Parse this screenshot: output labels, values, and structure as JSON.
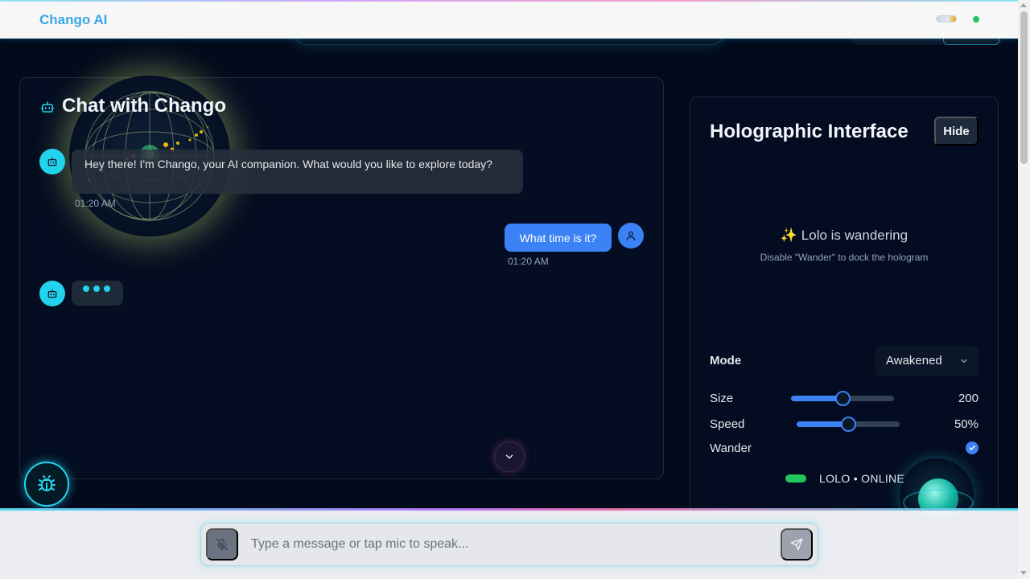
{
  "header": {
    "brand": "Chango AI",
    "theme_toggle": "theme-toggle",
    "status": "online"
  },
  "chat": {
    "title": "Chat with Chango",
    "messages": [
      {
        "role": "assistant",
        "text": "Hey there! I'm Chango, your AI companion. What would you like to explore today?",
        "time": "01:20 AM"
      },
      {
        "role": "user",
        "text": "What time is it?",
        "time": "01:20 AM"
      }
    ],
    "typing_indicator": true
  },
  "hologram": {
    "title": "Holographic Interface",
    "hide_label": "Hide",
    "wander_title": "✨ Lolo is wandering",
    "wander_hint": "Disable \"Wander\" to dock the hologram",
    "mode_label": "Mode",
    "mode_value": "Awakened",
    "size_label": "Size",
    "size_value": "200",
    "size_fraction": 0.5,
    "speed_label": "Speed",
    "speed_value": "50%",
    "speed_fraction": 0.5,
    "wander_label": "Wander",
    "wander_checked": true,
    "online_text": "LOLO • ONLINE"
  },
  "composer": {
    "placeholder": "Type a message or tap mic to speak..."
  },
  "colors": {
    "accent": "#22d3ee",
    "user_bubble": "#3b82f6",
    "online": "#22c55e"
  },
  "icons": [
    "bot-icon",
    "user-icon",
    "chevron-down-icon",
    "bug-icon",
    "mic-off-icon",
    "send-icon",
    "check-icon"
  ]
}
